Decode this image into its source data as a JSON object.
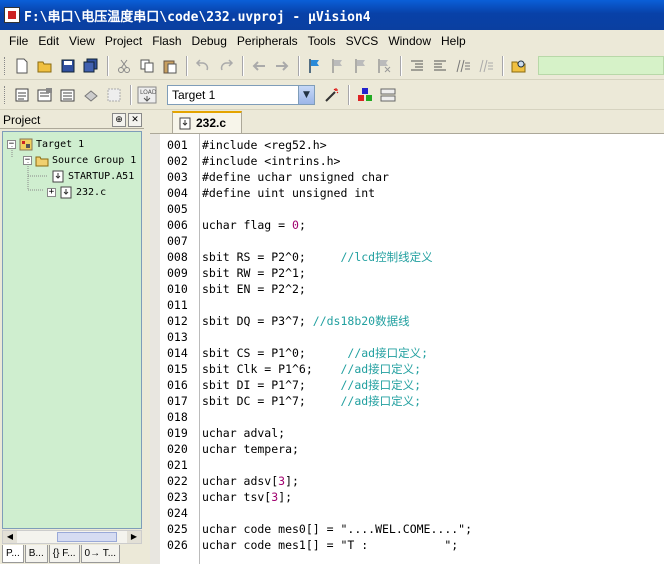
{
  "window": {
    "title": "F:\\串口\\电压温度串口\\code\\232.uvproj - μVision4"
  },
  "menu": [
    {
      "label": "File"
    },
    {
      "label": "Edit"
    },
    {
      "label": "View"
    },
    {
      "label": "Project"
    },
    {
      "label": "Flash"
    },
    {
      "label": "Debug"
    },
    {
      "label": "Peripherals"
    },
    {
      "label": "Tools"
    },
    {
      "label": "SVCS"
    },
    {
      "label": "Window"
    },
    {
      "label": "Help"
    }
  ],
  "build_toolbar": {
    "target_selected": "Target 1",
    "load_label": "LOAD"
  },
  "project_panel": {
    "title": "Project",
    "tree": [
      {
        "label": "Target 1"
      },
      {
        "label": "Source Group 1"
      },
      {
        "label": "STARTUP.A51"
      },
      {
        "label": "232.c"
      }
    ],
    "bottom_tabs": [
      {
        "label": "P..."
      },
      {
        "label": "B..."
      },
      {
        "label": "{} F..."
      },
      {
        "label": "0→ T..."
      }
    ]
  },
  "editor": {
    "active_tab": "232.c",
    "lines": [
      {
        "num": "001",
        "parts": [
          {
            "t": "#include <reg52.h>",
            "c": "kw"
          }
        ]
      },
      {
        "num": "002",
        "parts": [
          {
            "t": "#include <intrins.h>",
            "c": "kw"
          }
        ]
      },
      {
        "num": "003",
        "parts": [
          {
            "t": "#define uchar unsigned char",
            "c": "kw"
          }
        ]
      },
      {
        "num": "004",
        "parts": [
          {
            "t": "#define uint unsigned int",
            "c": "kw"
          }
        ]
      },
      {
        "num": "005",
        "parts": []
      },
      {
        "num": "006",
        "parts": [
          {
            "t": "uchar flag = ",
            "c": "kw"
          },
          {
            "t": "0",
            "c": "num-lit"
          },
          {
            "t": ";",
            "c": "kw"
          }
        ]
      },
      {
        "num": "007",
        "parts": []
      },
      {
        "num": "008",
        "parts": [
          {
            "t": "sbit RS = P2^0;     ",
            "c": "kw"
          },
          {
            "t": "//lcd控制线定义",
            "c": "cm"
          }
        ]
      },
      {
        "num": "009",
        "parts": [
          {
            "t": "sbit RW = P2^1;",
            "c": "kw"
          }
        ]
      },
      {
        "num": "010",
        "parts": [
          {
            "t": "sbit EN = P2^2;",
            "c": "kw"
          }
        ]
      },
      {
        "num": "011",
        "parts": []
      },
      {
        "num": "012",
        "parts": [
          {
            "t": "sbit DQ = P3^7; ",
            "c": "kw"
          },
          {
            "t": "//ds18b20数据线",
            "c": "cm"
          }
        ]
      },
      {
        "num": "013",
        "parts": []
      },
      {
        "num": "014",
        "parts": [
          {
            "t": "sbit CS = P1^0;      ",
            "c": "kw"
          },
          {
            "t": "//ad接口定义;",
            "c": "cm"
          }
        ]
      },
      {
        "num": "015",
        "parts": [
          {
            "t": "sbit Clk = P1^6;    ",
            "c": "kw"
          },
          {
            "t": "//ad接口定义;",
            "c": "cm"
          }
        ]
      },
      {
        "num": "016",
        "parts": [
          {
            "t": "sbit DI = P1^7;     ",
            "c": "kw"
          },
          {
            "t": "//ad接口定义;",
            "c": "cm"
          }
        ]
      },
      {
        "num": "017",
        "parts": [
          {
            "t": "sbit DC = P1^7;     ",
            "c": "kw"
          },
          {
            "t": "//ad接口定义;",
            "c": "cm"
          }
        ]
      },
      {
        "num": "018",
        "parts": []
      },
      {
        "num": "019",
        "parts": [
          {
            "t": "uchar adval;",
            "c": "kw"
          }
        ]
      },
      {
        "num": "020",
        "parts": [
          {
            "t": "uchar tempera;",
            "c": "kw"
          }
        ]
      },
      {
        "num": "021",
        "parts": []
      },
      {
        "num": "022",
        "parts": [
          {
            "t": "uchar adsv[",
            "c": "kw"
          },
          {
            "t": "3",
            "c": "num-lit"
          },
          {
            "t": "];",
            "c": "kw"
          }
        ]
      },
      {
        "num": "023",
        "parts": [
          {
            "t": "uchar tsv[",
            "c": "kw"
          },
          {
            "t": "3",
            "c": "num-lit"
          },
          {
            "t": "];",
            "c": "kw"
          }
        ]
      },
      {
        "num": "024",
        "parts": []
      },
      {
        "num": "025",
        "parts": [
          {
            "t": "uchar code mes0[] = \"....WEL.COME....\";",
            "c": "kw"
          }
        ]
      },
      {
        "num": "026",
        "parts": [
          {
            "t": "uchar code mes1[] = \"T :           \";",
            "c": "kw"
          }
        ]
      }
    ]
  },
  "colors": {
    "title_bar": "#0a46b4",
    "tree_bg": "#cfeecf",
    "comment": "#22a0a0",
    "number_literal": "#a0006e",
    "tab_accent": "#e4a400"
  }
}
